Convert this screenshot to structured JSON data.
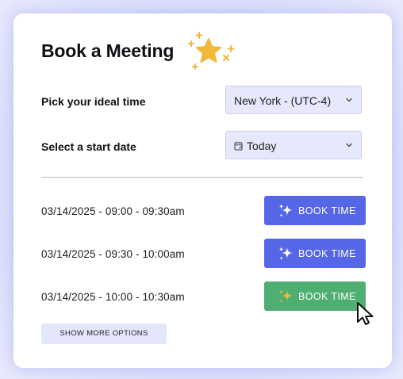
{
  "header": {
    "title": "Book a Meeting"
  },
  "timezone": {
    "label": "Pick your ideal time",
    "value": "New York - (UTC-4)"
  },
  "start_date": {
    "label": "Select a start date",
    "value": "Today"
  },
  "slots": [
    {
      "text": "03/14/2025 - 09:00 - 09:30am",
      "button": "BOOK TIME",
      "state": "default"
    },
    {
      "text": "03/14/2025 - 09:30 - 10:00am",
      "button": "BOOK TIME",
      "state": "default"
    },
    {
      "text": "03/14/2025 - 10:00 - 10:30am",
      "button": "BOOK TIME",
      "state": "hover"
    }
  ],
  "show_more": {
    "label": "SHOW MORE OPTIONS"
  },
  "colors": {
    "primary": "#5566e6",
    "hover": "#4fae72",
    "star": "#f2b83b",
    "select_bg": "#e6e9fb"
  },
  "icons": {
    "decoration": "stars-decoration-icon",
    "chevron": "chevron-down-icon",
    "calendar": "calendar-icon",
    "sparkle": "sparkle-icon",
    "cursor": "mouse-pointer-icon"
  }
}
